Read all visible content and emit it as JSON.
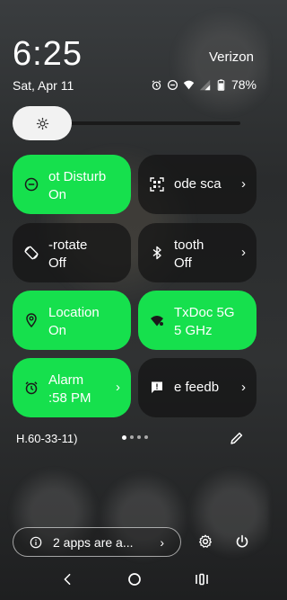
{
  "header": {
    "time": "6:25",
    "date": "Sat, Apr 11",
    "carrier": "Verizon",
    "battery": "78%"
  },
  "brightness": {
    "level": 0.22
  },
  "tiles": [
    {
      "line1": "ot Disturb",
      "line2": "On",
      "icon": "do-not-disturb-icon",
      "state": "on"
    },
    {
      "line1": "ode sca",
      "line2": "",
      "icon": "qr-scanner-icon",
      "state": "off"
    },
    {
      "line1": "-rotate",
      "line2": "Off",
      "icon": "auto-rotate-icon",
      "state": "off"
    },
    {
      "line1": "tooth",
      "line2": "Off",
      "icon": "bluetooth-icon",
      "state": "off"
    },
    {
      "line1": "Location",
      "line2": "On",
      "icon": "location-icon",
      "state": "on"
    },
    {
      "line1": "TxDoc 5G",
      "line2": "5 GHz",
      "icon": "wifi-icon",
      "state": "on"
    },
    {
      "line1": "Alarm",
      "line2": ":58 PM",
      "icon": "alarm-icon",
      "state": "on"
    },
    {
      "line1": "e feedb",
      "line2": "",
      "icon": "feedback-icon",
      "state": "off"
    }
  ],
  "build_number": "H.60-33-11)",
  "pager": {
    "pages": 4,
    "current": 1
  },
  "footer": {
    "notice": "2 apps are a..."
  }
}
